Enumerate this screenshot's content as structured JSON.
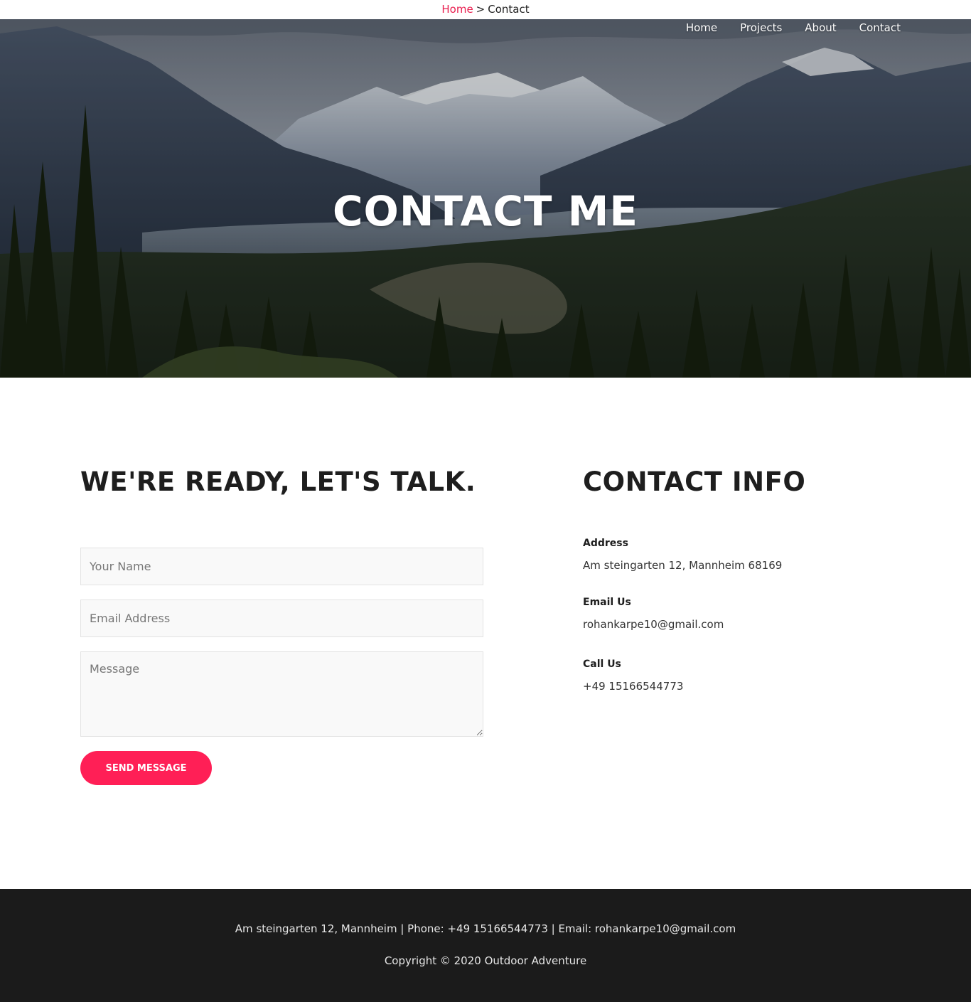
{
  "breadcrumb": {
    "home_label": "Home",
    "separator": ">",
    "current_label": "Contact"
  },
  "nav": {
    "items": [
      {
        "label": "Home"
      },
      {
        "label": "Projects"
      },
      {
        "label": "About"
      },
      {
        "label": "Contact"
      }
    ]
  },
  "hero": {
    "title": "CONTACT ME"
  },
  "form": {
    "heading": "WE'RE READY, LET'S TALK.",
    "name_placeholder": "Your Name",
    "email_placeholder": "Email Address",
    "message_placeholder": "Message",
    "submit_label": "SEND MESSAGE"
  },
  "contact_info": {
    "heading": "CONTACT INFO",
    "address_label": "Address",
    "address_value": "Am steingarten 12, Mannheim 68169",
    "email_label": "Email Us",
    "email_value": "rohankarpe10@gmail.com",
    "phone_label": "Call Us",
    "phone_value": "+49 15166544773"
  },
  "footer": {
    "contact_line": "Am steingarten 12, Mannheim | Phone: +49 15166544773 | Email: rohankarpe10@gmail.com",
    "copyright": "Copyright © 2020 Outdoor Adventure"
  },
  "colors": {
    "accent": "#ff1f56",
    "breadcrumb_link": "#e91e4f",
    "footer_bg": "#1b1b1b",
    "heading": "#1e1e1e"
  }
}
